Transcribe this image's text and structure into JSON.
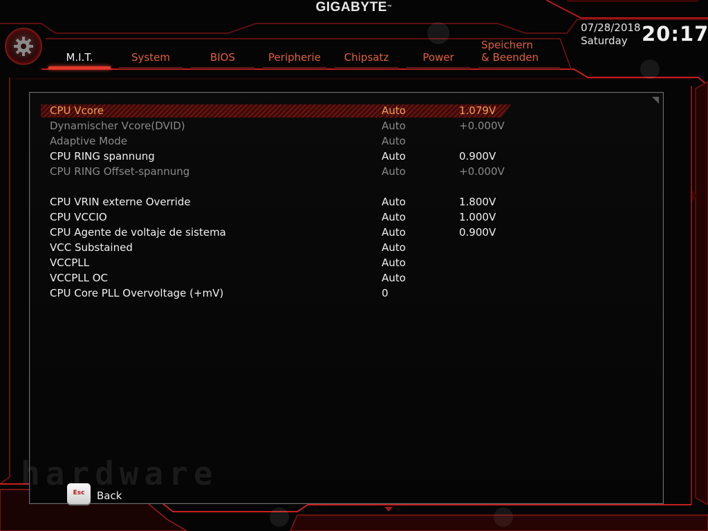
{
  "brand": "GIGABYTE",
  "brand_mark": "™",
  "tabs": [
    {
      "label": "M.I.T.",
      "active": true
    },
    {
      "label": "System"
    },
    {
      "label": "BIOS"
    },
    {
      "label": "Peripherie"
    },
    {
      "label": "Chipsatz"
    },
    {
      "label": "Power"
    },
    {
      "label": "Speichern & Beenden"
    }
  ],
  "clock": {
    "date": "07/28/2018",
    "day": "Saturday",
    "time": "20:17"
  },
  "settings": [
    {
      "name": "CPU Vcore",
      "mode": "Auto",
      "value": "1.079V",
      "state": "selected"
    },
    {
      "name": "Dynamischer Vcore(DVID)",
      "mode": "Auto",
      "value": "+0.000V",
      "state": "disabled"
    },
    {
      "name": "Adaptive Mode",
      "mode": "Auto",
      "value": "",
      "state": "disabled"
    },
    {
      "name": "CPU RING spannung",
      "mode": "Auto",
      "value": "0.900V",
      "state": "enabled"
    },
    {
      "name": "CPU RING Offset-spannung",
      "mode": "Auto",
      "value": "+0.000V",
      "state": "disabled"
    },
    {
      "name": "CPU VRIN externe Override",
      "mode": "Auto",
      "value": "1.800V",
      "state": "enabled"
    },
    {
      "name": "CPU VCCIO",
      "mode": "Auto",
      "value": "1.000V",
      "state": "enabled"
    },
    {
      "name": "CPU Agente de voltaje de sistema",
      "mode": "Auto",
      "value": "0.900V",
      "state": "enabled"
    },
    {
      "name": "VCC Substained",
      "mode": "Auto",
      "value": "",
      "state": "enabled"
    },
    {
      "name": "VCCPLL",
      "mode": "Auto",
      "value": "",
      "state": "enabled"
    },
    {
      "name": "VCCPLL OC",
      "mode": "Auto",
      "value": "",
      "state": "enabled"
    },
    {
      "name": "CPU Core PLL Overvoltage (+mV)",
      "mode": "0",
      "value": "",
      "state": "enabled"
    }
  ],
  "footer": {
    "esc_key": "Esc",
    "back_label": "Back"
  },
  "watermark": "hardware",
  "colors": {
    "accent": "#e23a2a",
    "tab_text": "#e0603a",
    "selected_text": "#f0a050",
    "disabled_text": "#8a8a8a"
  }
}
